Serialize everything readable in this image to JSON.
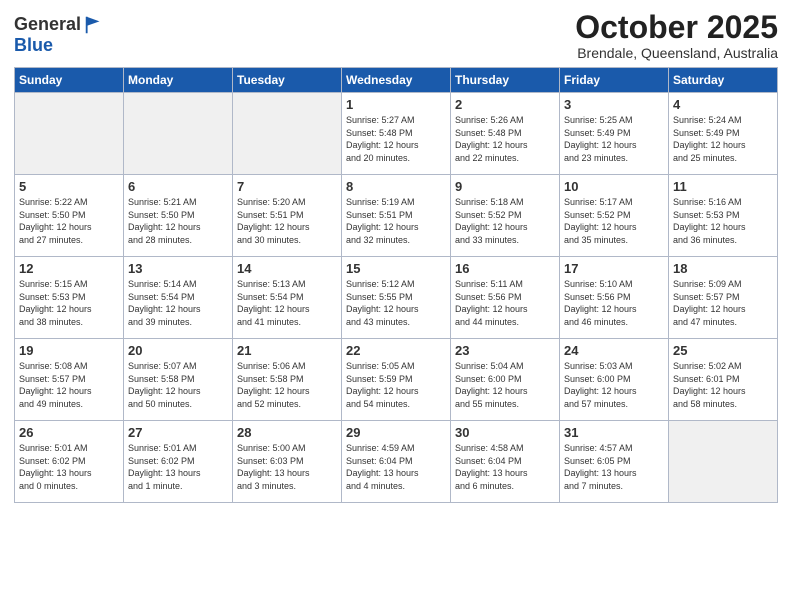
{
  "header": {
    "logo_general": "General",
    "logo_blue": "Blue",
    "month_title": "October 2025",
    "subtitle": "Brendale, Queensland, Australia"
  },
  "weekdays": [
    "Sunday",
    "Monday",
    "Tuesday",
    "Wednesday",
    "Thursday",
    "Friday",
    "Saturday"
  ],
  "weeks": [
    [
      {
        "day": "",
        "info": ""
      },
      {
        "day": "",
        "info": ""
      },
      {
        "day": "",
        "info": ""
      },
      {
        "day": "1",
        "info": "Sunrise: 5:27 AM\nSunset: 5:48 PM\nDaylight: 12 hours\nand 20 minutes."
      },
      {
        "day": "2",
        "info": "Sunrise: 5:26 AM\nSunset: 5:48 PM\nDaylight: 12 hours\nand 22 minutes."
      },
      {
        "day": "3",
        "info": "Sunrise: 5:25 AM\nSunset: 5:49 PM\nDaylight: 12 hours\nand 23 minutes."
      },
      {
        "day": "4",
        "info": "Sunrise: 5:24 AM\nSunset: 5:49 PM\nDaylight: 12 hours\nand 25 minutes."
      }
    ],
    [
      {
        "day": "5",
        "info": "Sunrise: 5:22 AM\nSunset: 5:50 PM\nDaylight: 12 hours\nand 27 minutes."
      },
      {
        "day": "6",
        "info": "Sunrise: 5:21 AM\nSunset: 5:50 PM\nDaylight: 12 hours\nand 28 minutes."
      },
      {
        "day": "7",
        "info": "Sunrise: 5:20 AM\nSunset: 5:51 PM\nDaylight: 12 hours\nand 30 minutes."
      },
      {
        "day": "8",
        "info": "Sunrise: 5:19 AM\nSunset: 5:51 PM\nDaylight: 12 hours\nand 32 minutes."
      },
      {
        "day": "9",
        "info": "Sunrise: 5:18 AM\nSunset: 5:52 PM\nDaylight: 12 hours\nand 33 minutes."
      },
      {
        "day": "10",
        "info": "Sunrise: 5:17 AM\nSunset: 5:52 PM\nDaylight: 12 hours\nand 35 minutes."
      },
      {
        "day": "11",
        "info": "Sunrise: 5:16 AM\nSunset: 5:53 PM\nDaylight: 12 hours\nand 36 minutes."
      }
    ],
    [
      {
        "day": "12",
        "info": "Sunrise: 5:15 AM\nSunset: 5:53 PM\nDaylight: 12 hours\nand 38 minutes."
      },
      {
        "day": "13",
        "info": "Sunrise: 5:14 AM\nSunset: 5:54 PM\nDaylight: 12 hours\nand 39 minutes."
      },
      {
        "day": "14",
        "info": "Sunrise: 5:13 AM\nSunset: 5:54 PM\nDaylight: 12 hours\nand 41 minutes."
      },
      {
        "day": "15",
        "info": "Sunrise: 5:12 AM\nSunset: 5:55 PM\nDaylight: 12 hours\nand 43 minutes."
      },
      {
        "day": "16",
        "info": "Sunrise: 5:11 AM\nSunset: 5:56 PM\nDaylight: 12 hours\nand 44 minutes."
      },
      {
        "day": "17",
        "info": "Sunrise: 5:10 AM\nSunset: 5:56 PM\nDaylight: 12 hours\nand 46 minutes."
      },
      {
        "day": "18",
        "info": "Sunrise: 5:09 AM\nSunset: 5:57 PM\nDaylight: 12 hours\nand 47 minutes."
      }
    ],
    [
      {
        "day": "19",
        "info": "Sunrise: 5:08 AM\nSunset: 5:57 PM\nDaylight: 12 hours\nand 49 minutes."
      },
      {
        "day": "20",
        "info": "Sunrise: 5:07 AM\nSunset: 5:58 PM\nDaylight: 12 hours\nand 50 minutes."
      },
      {
        "day": "21",
        "info": "Sunrise: 5:06 AM\nSunset: 5:58 PM\nDaylight: 12 hours\nand 52 minutes."
      },
      {
        "day": "22",
        "info": "Sunrise: 5:05 AM\nSunset: 5:59 PM\nDaylight: 12 hours\nand 54 minutes."
      },
      {
        "day": "23",
        "info": "Sunrise: 5:04 AM\nSunset: 6:00 PM\nDaylight: 12 hours\nand 55 minutes."
      },
      {
        "day": "24",
        "info": "Sunrise: 5:03 AM\nSunset: 6:00 PM\nDaylight: 12 hours\nand 57 minutes."
      },
      {
        "day": "25",
        "info": "Sunrise: 5:02 AM\nSunset: 6:01 PM\nDaylight: 12 hours\nand 58 minutes."
      }
    ],
    [
      {
        "day": "26",
        "info": "Sunrise: 5:01 AM\nSunset: 6:02 PM\nDaylight: 13 hours\nand 0 minutes."
      },
      {
        "day": "27",
        "info": "Sunrise: 5:01 AM\nSunset: 6:02 PM\nDaylight: 13 hours\nand 1 minute."
      },
      {
        "day": "28",
        "info": "Sunrise: 5:00 AM\nSunset: 6:03 PM\nDaylight: 13 hours\nand 3 minutes."
      },
      {
        "day": "29",
        "info": "Sunrise: 4:59 AM\nSunset: 6:04 PM\nDaylight: 13 hours\nand 4 minutes."
      },
      {
        "day": "30",
        "info": "Sunrise: 4:58 AM\nSunset: 6:04 PM\nDaylight: 13 hours\nand 6 minutes."
      },
      {
        "day": "31",
        "info": "Sunrise: 4:57 AM\nSunset: 6:05 PM\nDaylight: 13 hours\nand 7 minutes."
      },
      {
        "day": "",
        "info": ""
      }
    ]
  ]
}
